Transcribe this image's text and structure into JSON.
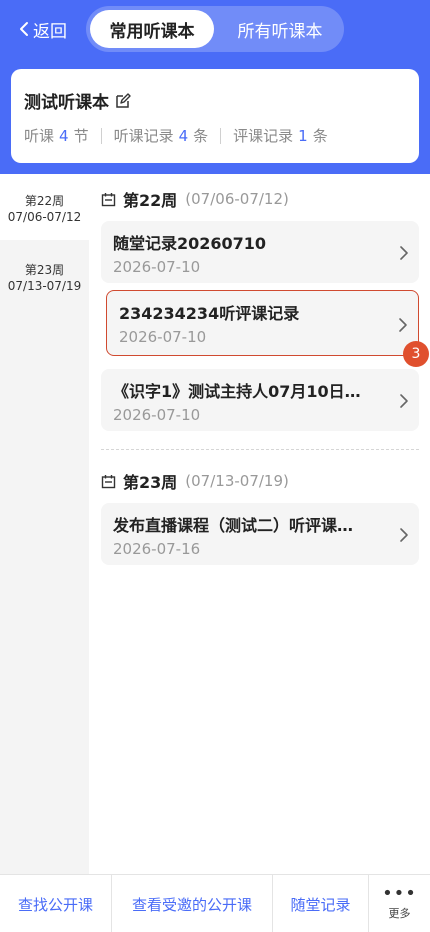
{
  "header": {
    "back_label": "返回",
    "tabs": [
      {
        "label": "常用听课本",
        "active": true
      },
      {
        "label": "所有听课本",
        "active": false
      }
    ]
  },
  "book": {
    "title": "测试听课本",
    "stats": [
      {
        "prefix": "听课",
        "value": "4",
        "suffix": "节"
      },
      {
        "prefix": "听课记录",
        "value": "4",
        "suffix": "条"
      },
      {
        "prefix": "评课记录",
        "value": "1",
        "suffix": "条"
      }
    ]
  },
  "sidebar": {
    "items": [
      {
        "week": "第22周",
        "range": "07/06-07/12",
        "selected": true
      },
      {
        "week": "第23周",
        "range": "07/13-07/19",
        "selected": false
      }
    ]
  },
  "weeks": [
    {
      "label": "第22周",
      "range": "(07/06-07/12)",
      "records": [
        {
          "title": "随堂记录20260710",
          "date": "2026-07-10"
        },
        {
          "title": "234234234听评课记录",
          "date": "2026-07-10",
          "badge": "3"
        },
        {
          "title": "《识字1》测试主持人07月10日…",
          "date": "2026-07-10"
        }
      ]
    },
    {
      "label": "第23周",
      "range": "(07/13-07/19)",
      "records": [
        {
          "title": "发布直播课程（测试二）听评课…",
          "date": "2026-07-16"
        }
      ]
    }
  ],
  "bottom_tabs": [
    {
      "label": "查找公开课"
    },
    {
      "label": "查看受邀的公开课"
    },
    {
      "label": "随堂记录"
    },
    {
      "label": "更多",
      "icon": "more-dots-icon"
    }
  ],
  "colors": {
    "primary": "#4a6cf7",
    "highlight_border": "#d04a30",
    "badge": "#e0502e"
  }
}
